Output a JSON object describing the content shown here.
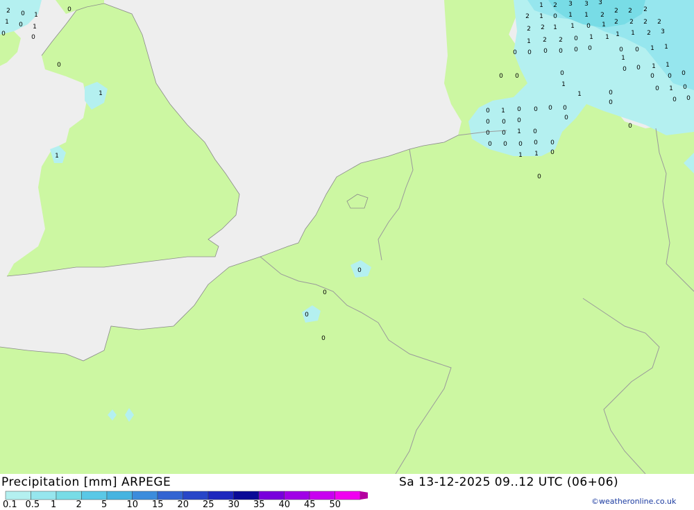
{
  "header": {
    "title": "Precipitation [mm] ARPEGE",
    "datetime": "Sa 13-12-2025 09..12 UTC (06+06)",
    "credit": "©weatheronline.co.uk"
  },
  "legend": {
    "ticks": [
      "0.1",
      "0.5",
      "1",
      "2",
      "5",
      "10",
      "15",
      "20",
      "25",
      "30",
      "35",
      "40",
      "45",
      "50"
    ],
    "colors": [
      "#b4f0f0",
      "#96e6ee",
      "#78dce6",
      "#5ac8e6",
      "#46b4e0",
      "#3c8cdc",
      "#3264d2",
      "#2846c8",
      "#1e28be",
      "#0a0a96",
      "#7800dc",
      "#a000e6",
      "#c800f0",
      "#f000f0",
      "#d200c8",
      "#b400a0"
    ]
  },
  "colors": {
    "sea": "#eeeeee",
    "land": "#ccf7a2",
    "rain_light": "#b4f0f0",
    "rain_med": "#96e6ee",
    "rain_heavy": "#78dce6",
    "border": "#9a9a9a"
  },
  "map_values": [
    "2",
    "0",
    "1",
    "1",
    "0",
    "1",
    "0",
    "0",
    "0",
    "0",
    "1",
    "1",
    "1",
    "2",
    "3",
    "3",
    "3",
    "2",
    "2",
    "2",
    "2",
    "1",
    "0",
    "1",
    "1",
    "2",
    "2",
    "2",
    "2",
    "2",
    "2",
    "2",
    "1",
    "1",
    "0",
    "1",
    "1",
    "1",
    "2",
    "3",
    "1",
    "2",
    "2",
    "0",
    "1",
    "1",
    "0",
    "0",
    "1",
    "1",
    "0",
    "0",
    "0",
    "0",
    "0",
    "0",
    "1",
    "0",
    "1",
    "1",
    "0",
    "0",
    "0",
    "0",
    "0",
    "1",
    "0",
    "0",
    "0",
    "0",
    "1",
    "1",
    "0",
    "0",
    "0",
    "0",
    "0",
    "1",
    "0",
    "0",
    "0",
    "0",
    "0",
    "0",
    "0",
    "0",
    "0",
    "0",
    "1",
    "0",
    "0",
    "0",
    "0",
    "0",
    "1",
    "1",
    "0",
    "0",
    "0",
    "0",
    "0",
    "0",
    "0",
    "0"
  ]
}
